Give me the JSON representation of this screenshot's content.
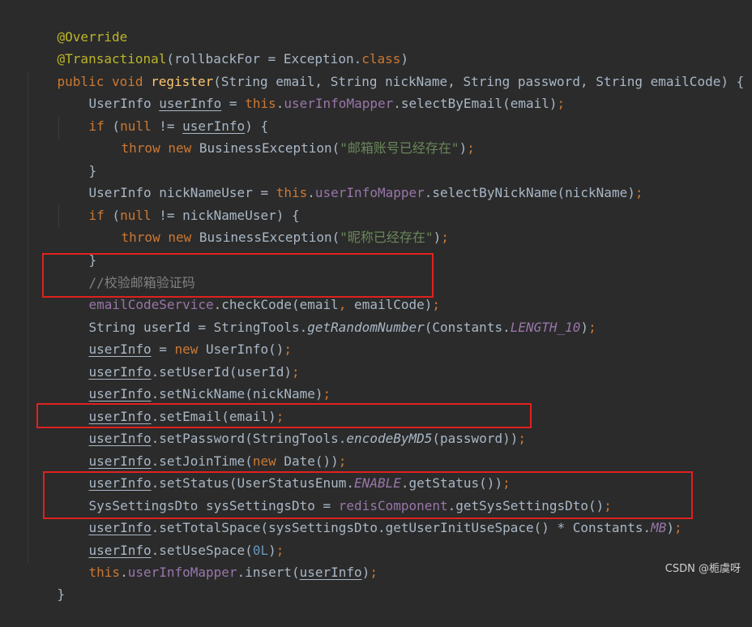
{
  "code": {
    "line1": {
      "ann": "@Override"
    },
    "line2": {
      "ann": "@Transactional",
      "a": "(rollbackFor = Exception.",
      "kw": "class",
      "b": ")"
    },
    "line3": {
      "kw1": "public",
      "kw2": "void",
      "fn": "register",
      "rest": "(String email, String nickName, String password, String emailCode) {"
    },
    "line4": {
      "type": "UserInfo ",
      "var": "userInfo",
      "eq": " = ",
      "this": "this",
      "dot": ".",
      "field": "userInfoMapper",
      "call": ".selectByEmail(email)",
      "semi": ";"
    },
    "line5": {
      "kw": "if",
      "a": " (",
      "null": "null",
      "b": " != ",
      "var": "userInfo",
      "c": ") {"
    },
    "line6": {
      "kw1": "throw",
      "kw2": "new",
      "a": " BusinessException(",
      "str": "\"邮箱账号已经存在\"",
      "b": ")",
      "semi": ";"
    },
    "line7": {
      "text": "}"
    },
    "line8": {
      "a": "UserInfo nickNameUser = ",
      "this": "this",
      "dot": ".",
      "field": "userInfoMapper",
      "call": ".selectByNickName(nickName)",
      "semi": ";"
    },
    "line9": {
      "kw": "if",
      "a": " (",
      "null": "null",
      "b": " != nickNameUser) {"
    },
    "line10": {
      "kw1": "throw",
      "kw2": "new",
      "a": " BusinessException(",
      "str": "\"昵称已经存在\"",
      "b": ")",
      "semi": ";"
    },
    "line11": {
      "text": "}"
    },
    "line12": {
      "comment": "//校验邮箱验证码"
    },
    "line13": {
      "field": "emailCodeService",
      "a": ".checkCode(email",
      "comma": ",",
      "b": " emailCode)",
      "semi": ";"
    },
    "line14": {
      "a": "String userId = StringTools.",
      "mi": "getRandomNumber",
      "b": "(Constants.",
      "field": "LENGTH_10",
      "c": ")",
      "semi": ";"
    },
    "line15": {
      "var": "userInfo",
      "a": " = ",
      "kw": "new",
      "b": " UserInfo()",
      "semi": ";"
    },
    "line16": {
      "var": "userInfo",
      "a": ".setUserId(userId)",
      "semi": ";"
    },
    "line17": {
      "var": "userInfo",
      "a": ".setNickName(nickName)",
      "semi": ";"
    },
    "line18": {
      "var": "userInfo",
      "a": ".setEmail(email)",
      "semi": ";"
    },
    "line19": {
      "var": "userInfo",
      "a": ".setPassword(StringTools.",
      "mi": "encodeByMD5",
      "b": "(password))",
      "semi": ";"
    },
    "line20": {
      "var": "userInfo",
      "a": ".setJoinTime(",
      "kw": "new",
      "b": " Date())",
      "semi": ";"
    },
    "line21": {
      "var": "userInfo",
      "a": ".setStatus(UserStatusEnum.",
      "field": "ENABLE",
      "b": ".getStatus())",
      "semi": ";"
    },
    "line22": {
      "a": "SysSettingsDto sysSettingsDto = ",
      "field": "redisComponent",
      "b": ".getSysSettingsDto()",
      "semi": ";"
    },
    "line23": {
      "var": "userInfo",
      "a": ".setTotalSpace(sysSettingsDto.getUserInitUseSpace() * Constants.",
      "field": "MB",
      "b": ")",
      "semi": ";"
    },
    "line24": {
      "var": "userInfo",
      "a": ".setUseSpace(",
      "num": "0L",
      "b": ")",
      "semi": ";"
    },
    "line25": {
      "this": "this",
      "dot": ".",
      "field": "userInfoMapper",
      "a": ".insert(",
      "var": "userInfo",
      "b": ")",
      "semi": ";"
    },
    "line26": {
      "text": "}"
    }
  },
  "watermark": "CSDN @栀虞呀",
  "colors": {
    "background": "#2b2b2b",
    "keyword": "#cc7832",
    "annotation": "#bbb529",
    "method": "#ffc66d",
    "field": "#9876aa",
    "string": "#6a8759",
    "number": "#6897bb",
    "comment": "#808080",
    "highlight": "#e0211e"
  }
}
